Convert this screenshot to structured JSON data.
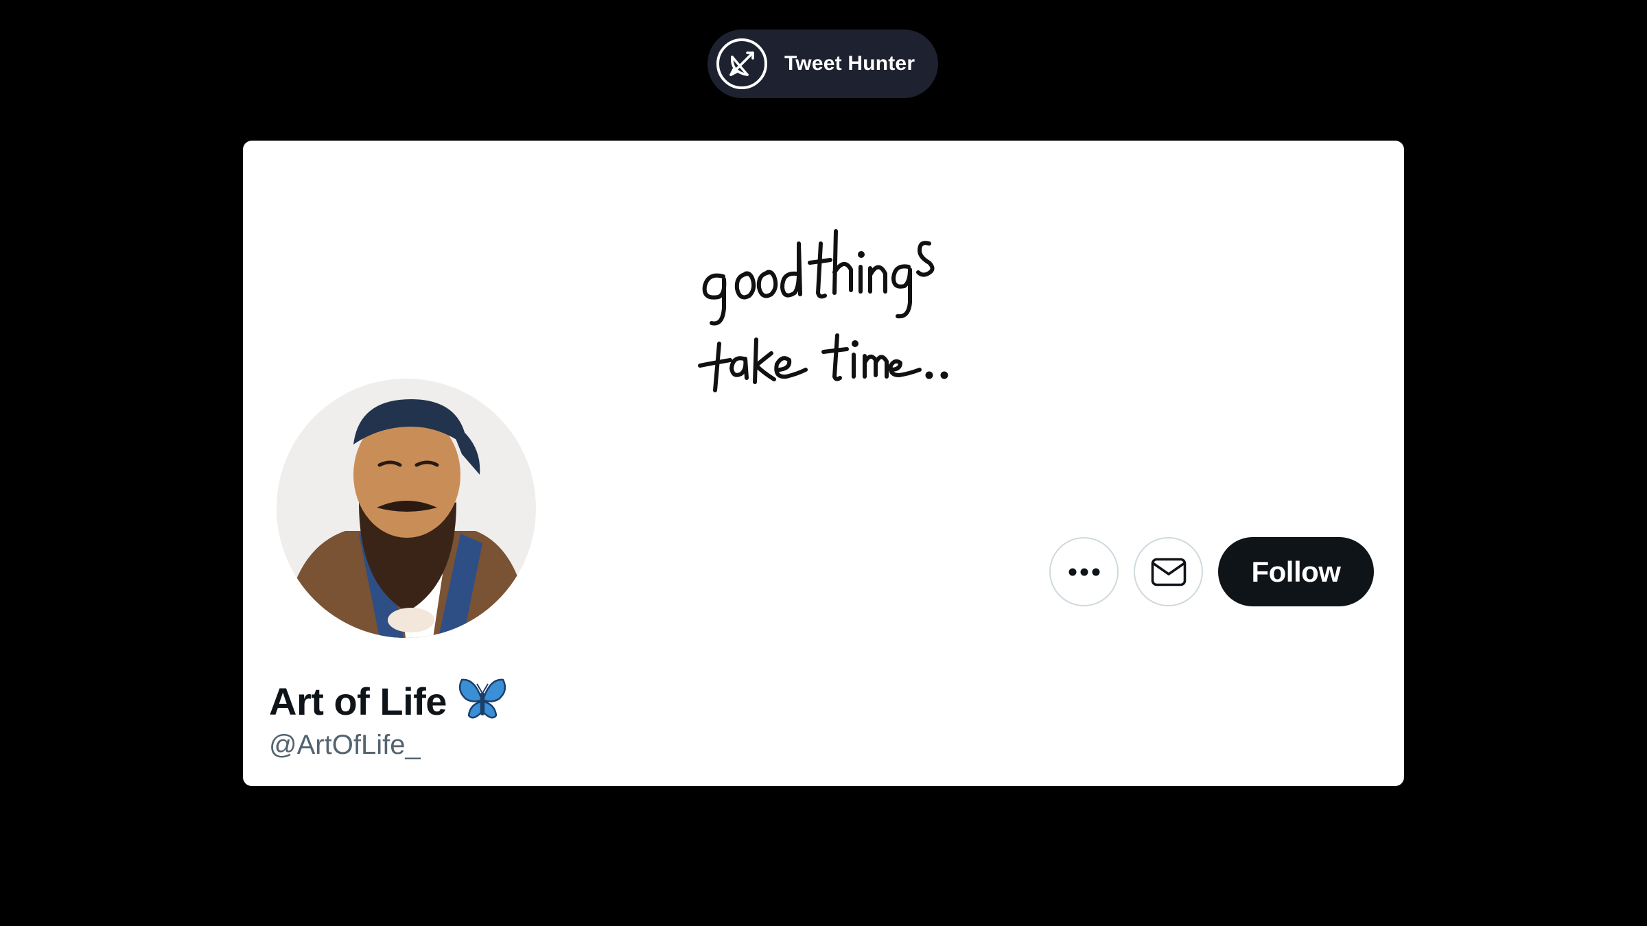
{
  "brand": {
    "name": "Tweet Hunter",
    "logo_icon": "bow-arrow-icon"
  },
  "profile": {
    "banner_text_line1": "good things",
    "banner_text_line2": "take time..",
    "avatar_icon": "portrait-avatar",
    "display_name": "Art of Life",
    "badge_icon": "butterfly-emoji-icon",
    "handle": "@ArtOfLife_"
  },
  "actions": {
    "more_icon": "more-dots-icon",
    "message_icon": "mail-icon",
    "follow_label": "Follow"
  },
  "colors": {
    "page_bg": "#000000",
    "pill_bg": "#1e2230",
    "card_bg": "#ffffff",
    "follow_bg": "#0f1419",
    "handle_text": "#536471",
    "butterfly": "#3a8fd6"
  }
}
